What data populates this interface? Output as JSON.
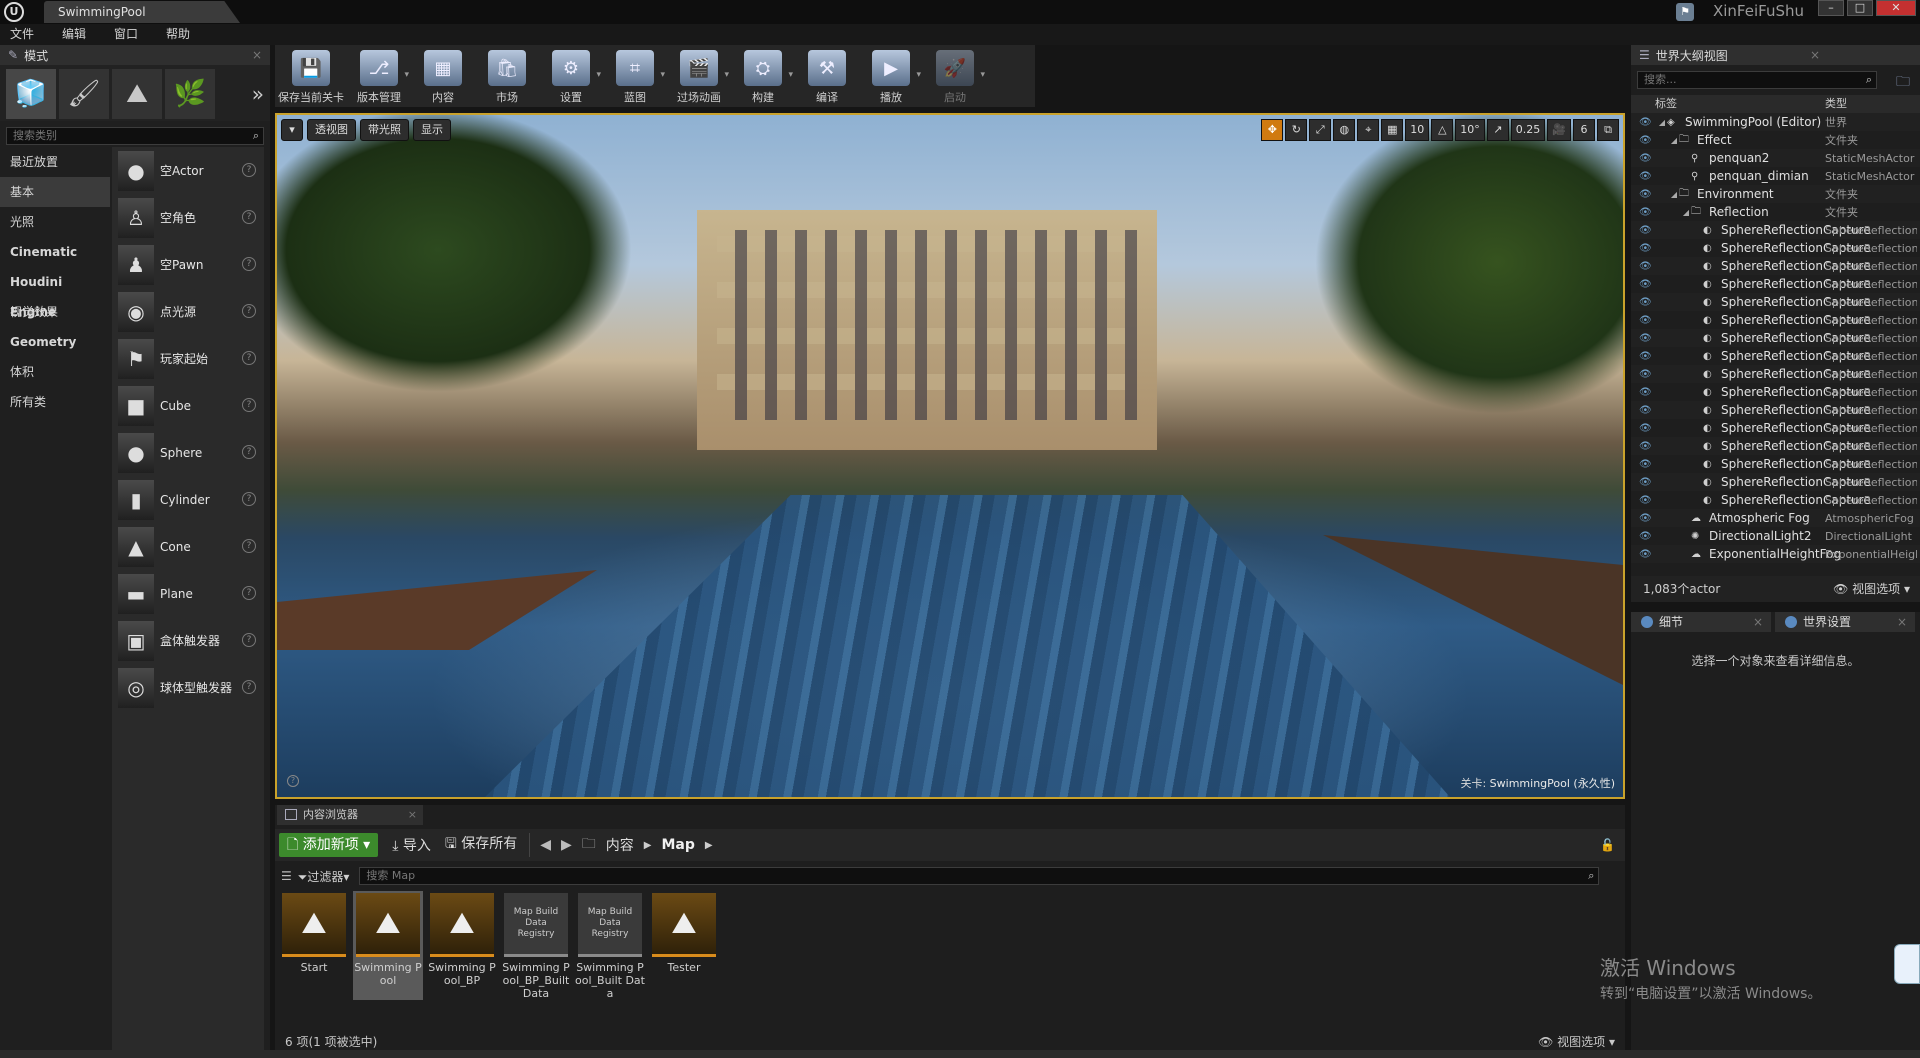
{
  "titlebar": {
    "tab_title": "SwimmingPool",
    "brand": "XinFeiFuShu"
  },
  "menu": [
    "文件",
    "编辑",
    "窗口",
    "帮助"
  ],
  "modes": {
    "tab_label": "模式",
    "search_placeholder": "搜索类别",
    "categories": [
      {
        "label": "最近放置",
        "bold": false
      },
      {
        "label": "基本",
        "bold": false,
        "active": true
      },
      {
        "label": "光照",
        "bold": false
      },
      {
        "label": "Cinematic",
        "bold": true
      },
      {
        "label": "Houdini Engine",
        "bold": true
      },
      {
        "label": "视觉效果",
        "bold": false
      },
      {
        "label": "Geometry",
        "bold": true
      },
      {
        "label": "体积",
        "bold": false
      },
      {
        "label": "所有类",
        "bold": false
      }
    ],
    "assets": [
      "空Actor",
      "空角色",
      "空Pawn",
      "点光源",
      "玩家起始",
      "Cube",
      "Sphere",
      "Cylinder",
      "Cone",
      "Plane",
      "盒体触发器",
      "球体型触发器"
    ]
  },
  "toolbar": [
    {
      "label": "保存当前关卡",
      "icon": "save-icon",
      "dropdown": false
    },
    {
      "label": "版本管理",
      "icon": "source-control-icon",
      "dropdown": true
    },
    {
      "label": "内容",
      "icon": "content-icon",
      "dropdown": false
    },
    {
      "label": "市场",
      "icon": "marketplace-icon",
      "dropdown": false
    },
    {
      "label": "设置",
      "icon": "settings-icon",
      "dropdown": true
    },
    {
      "label": "蓝图",
      "icon": "blueprint-icon",
      "dropdown": true
    },
    {
      "label": "过场动画",
      "icon": "cinematics-icon",
      "dropdown": true
    },
    {
      "label": "构建",
      "icon": "build-icon",
      "dropdown": true
    },
    {
      "label": "编译",
      "icon": "compile-icon",
      "dropdown": false
    },
    {
      "label": "播放",
      "icon": "play-icon",
      "dropdown": true
    },
    {
      "label": "启动",
      "icon": "launch-icon",
      "dropdown": true,
      "disabled": true
    }
  ],
  "viewport": {
    "perspective": "透视图",
    "lit": "带光照",
    "show": "显示",
    "grid_snap": "10",
    "rot_snap": "10°",
    "scale_snap": "0.25",
    "camera_speed": "6",
    "level_label": "关卡:",
    "level_name": "SwimmingPool (永久性)"
  },
  "content_browser": {
    "tab_label": "内容浏览器",
    "add_new": "添加新项",
    "import": "导入",
    "save_all": "保存所有",
    "crumbs": [
      "内容",
      "Map"
    ],
    "filters": "过滤器",
    "search_placeholder": "搜索 Map",
    "assets": [
      {
        "label": "Start",
        "kind": "map",
        "selected": false
      },
      {
        "label": "Swimming Pool",
        "kind": "map",
        "selected": true
      },
      {
        "label": "Swimming Pool_BP",
        "kind": "map",
        "selected": false
      },
      {
        "label": "Swimming Pool_BP_Built Data",
        "kind": "registry",
        "selected": false
      },
      {
        "label": "Swimming Pool_Built Data",
        "kind": "registry",
        "selected": false
      },
      {
        "label": "Tester",
        "kind": "map",
        "selected": false
      }
    ],
    "registry_thumb": "Map Build Data Registry",
    "status": "6 项(1 项被选中)",
    "view_options": "视图选项"
  },
  "outliner": {
    "tab_label": "世界大纲视图",
    "search_placeholder": "搜索...",
    "col_label": "标签",
    "col_type": "类型",
    "rows": [
      {
        "label": "SwimmingPool (Editor)",
        "type": "世界",
        "indent": 1,
        "icon": "world-icon"
      },
      {
        "label": "Effect",
        "type": "文件夹",
        "indent": 2,
        "icon": "folder-icon"
      },
      {
        "label": "penquan2",
        "type": "StaticMeshActor",
        "indent": 3,
        "icon": "mesh-icon"
      },
      {
        "label": "penquan_dimian",
        "type": "StaticMeshActor",
        "indent": 3,
        "icon": "mesh-icon"
      },
      {
        "label": "Environment",
        "type": "文件夹",
        "indent": 2,
        "icon": "folder-icon"
      },
      {
        "label": "Reflection",
        "type": "文件夹",
        "indent": 3,
        "icon": "folder-icon"
      },
      {
        "label": "SphereReflectionCapture",
        "type": "SphereReflectionCapture",
        "indent": 4,
        "icon": "reflection-icon"
      },
      {
        "label": "SphereReflectionCapture",
        "type": "SphereReflectionCapture",
        "indent": 4,
        "icon": "reflection-icon"
      },
      {
        "label": "SphereReflectionCapture",
        "type": "SphereReflectionCapture",
        "indent": 4,
        "icon": "reflection-icon"
      },
      {
        "label": "SphereReflectionCapture",
        "type": "SphereReflectionCapture",
        "indent": 4,
        "icon": "reflection-icon"
      },
      {
        "label": "SphereReflectionCapture",
        "type": "SphereReflectionCapture",
        "indent": 4,
        "icon": "reflection-icon"
      },
      {
        "label": "SphereReflectionCapture",
        "type": "SphereReflectionCapture",
        "indent": 4,
        "icon": "reflection-icon"
      },
      {
        "label": "SphereReflectionCapture",
        "type": "SphereReflectionCapture",
        "indent": 4,
        "icon": "reflection-icon"
      },
      {
        "label": "SphereReflectionCapture",
        "type": "SphereReflectionCapture",
        "indent": 4,
        "icon": "reflection-icon"
      },
      {
        "label": "SphereReflectionCapture",
        "type": "SphereReflectionCapture",
        "indent": 4,
        "icon": "reflection-icon"
      },
      {
        "label": "SphereReflectionCapture",
        "type": "SphereReflectionCapture",
        "indent": 4,
        "icon": "reflection-icon"
      },
      {
        "label": "SphereReflectionCapture",
        "type": "SphereReflectionCapture",
        "indent": 4,
        "icon": "reflection-icon"
      },
      {
        "label": "SphereReflectionCapture",
        "type": "SphereReflectionCapture",
        "indent": 4,
        "icon": "reflection-icon"
      },
      {
        "label": "SphereReflectionCapture",
        "type": "SphereReflectionCapture",
        "indent": 4,
        "icon": "reflection-icon"
      },
      {
        "label": "SphereReflectionCapture",
        "type": "SphereReflectionCapture",
        "indent": 4,
        "icon": "reflection-icon"
      },
      {
        "label": "SphereReflectionCapture",
        "type": "SphereReflectionCapture",
        "indent": 4,
        "icon": "reflection-icon"
      },
      {
        "label": "SphereReflectionCapture",
        "type": "SphereReflectionCapture",
        "indent": 4,
        "icon": "reflection-icon"
      },
      {
        "label": "Atmospheric Fog",
        "type": "AtmosphericFog",
        "indent": 3,
        "icon": "fog-icon"
      },
      {
        "label": "DirectionalLight2",
        "type": "DirectionalLight",
        "indent": 3,
        "icon": "light-icon"
      },
      {
        "label": "ExponentialHeightFog",
        "type": "ExponentialHeightFog",
        "indent": 3,
        "icon": "fog-icon"
      }
    ],
    "actor_count": "1,083个actor",
    "view_options": "视图选项"
  },
  "details": {
    "tab_details": "细节",
    "tab_world": "世界设置",
    "empty_msg": "选择一个对象来查看详细信息。"
  },
  "watermark": {
    "line1": "激活 Windows",
    "line2": "转到“电脑设置”以激活 Windows。"
  }
}
